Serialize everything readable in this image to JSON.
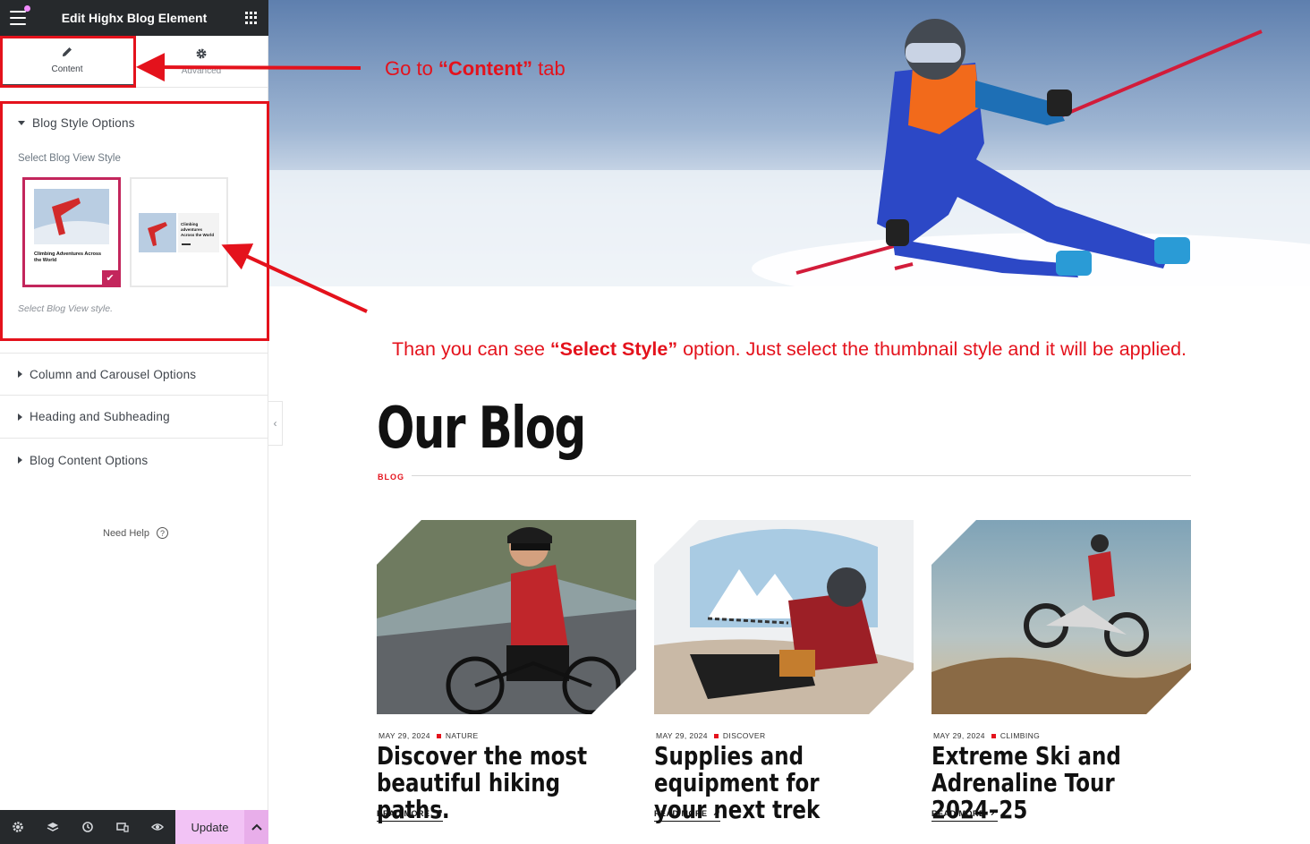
{
  "editor": {
    "title": "Edit Highx Blog Element",
    "tabs": [
      {
        "label": "Content",
        "icon": "pencil-icon"
      },
      {
        "label": "Advanced",
        "icon": "gear-icon"
      }
    ],
    "sections": [
      {
        "label": "Blog Style Options",
        "open": true
      },
      {
        "label": "Column and Carousel Options",
        "open": false
      },
      {
        "label": "Heading and Subheading",
        "open": false
      },
      {
        "label": "Blog Content Options",
        "open": false
      }
    ],
    "style_field": {
      "label": "Select Blog View Style",
      "help": "Select Blog View style.",
      "thumb1_title": "Climbing Adventures Across the World",
      "thumb2_title": "Climbing adventures Across the World"
    },
    "need_help": "Need Help",
    "update_label": "Update"
  },
  "annotations": {
    "tab_note": {
      "pre": "Go  to ",
      "bold": "“Content”",
      "post": " tab"
    },
    "style_note": {
      "pre": "Than you can see ",
      "bold": "“Select Style”",
      "post": " option. Just select the thumbnail style and it will be applied."
    }
  },
  "blog": {
    "title": "Our Blog",
    "tag": "BLOG",
    "posts": [
      {
        "date": "MAY 29, 2024",
        "category": "NATURE",
        "title": "Discover the most beautiful hiking paths.",
        "read_more": "READ MORE"
      },
      {
        "date": "MAY 29, 2024",
        "category": "DISCOVER",
        "title": "Supplies and equipment for your next trek",
        "read_more": "READ MORE"
      },
      {
        "date": "MAY 29, 2024",
        "category": "CLIMBING",
        "title": "Extreme Ski and Adrenaline Tour 2024–25",
        "read_more": "READ MORE"
      }
    ]
  },
  "colors": {
    "accent_red": "#e4121c",
    "editor_dark": "#26292c",
    "update_pink": "#f2c3f5",
    "selected_border": "#c3265c"
  }
}
